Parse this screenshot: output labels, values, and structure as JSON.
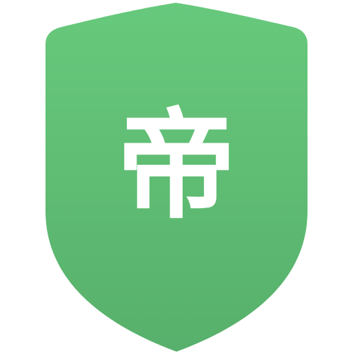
{
  "app_icon": {
    "glyph": "帝",
    "icon_name": "shield-icon",
    "colors": {
      "shield_top": "#67c97c",
      "shield_bottom": "#57b06b",
      "glyph": "#ffffff",
      "background": "#ffffff"
    }
  }
}
